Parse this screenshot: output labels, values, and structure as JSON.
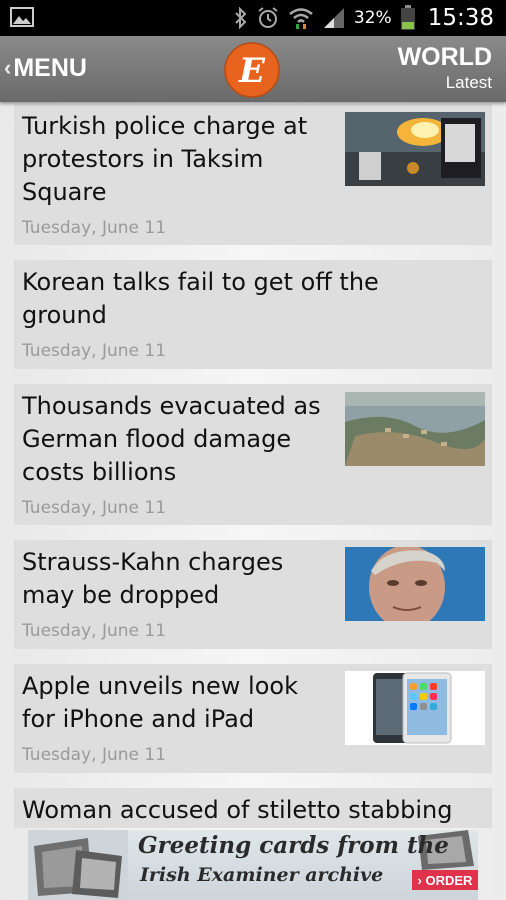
{
  "status_bar": {
    "icons": [
      "gallery-icon",
      "bluetooth-icon",
      "alarm-icon",
      "wifi-icon",
      "signal-icon",
      "battery-icon"
    ],
    "battery_percent": "32%",
    "time": "15:38"
  },
  "header": {
    "menu_label": "MENU",
    "menu_chevron": "‹",
    "logo_letter": "E",
    "section_title": "WORLD",
    "section_subtitle": "Latest",
    "colors": {
      "header_bg": "#7a7a7a",
      "logo_orange": "#e8641e"
    }
  },
  "articles": [
    {
      "lines": [
        "Turkish police charge at",
        "protestors in Taksim",
        "Square"
      ],
      "date": "Tuesday, June 11",
      "thumbnail": "protest-photo"
    },
    {
      "lines": [
        "Korean talks fail to get off the",
        "ground"
      ],
      "date": "Tuesday, June 11",
      "thumbnail": null
    },
    {
      "lines": [
        "Thousands evacuated as",
        "German flood damage",
        "costs billions"
      ],
      "date": "Tuesday, June 11",
      "thumbnail": "flood-photo"
    },
    {
      "lines": [
        "Strauss-Kahn charges",
        "may be dropped"
      ],
      "date": "Tuesday, June 11",
      "thumbnail": "portrait-photo"
    },
    {
      "lines": [
        "Apple unveils new look",
        "for iPhone and iPad"
      ],
      "date": "Tuesday, June 11",
      "thumbnail": "iphone-photo"
    },
    {
      "lines": [
        "Woman accused of stiletto stabbing"
      ],
      "date": "",
      "thumbnail": null
    }
  ],
  "ad": {
    "line1": "Greeting cards from the",
    "line2": "Irish Examiner archive",
    "order_label": "› ORDER",
    "colors": {
      "order_bg": "#e0324b"
    }
  }
}
